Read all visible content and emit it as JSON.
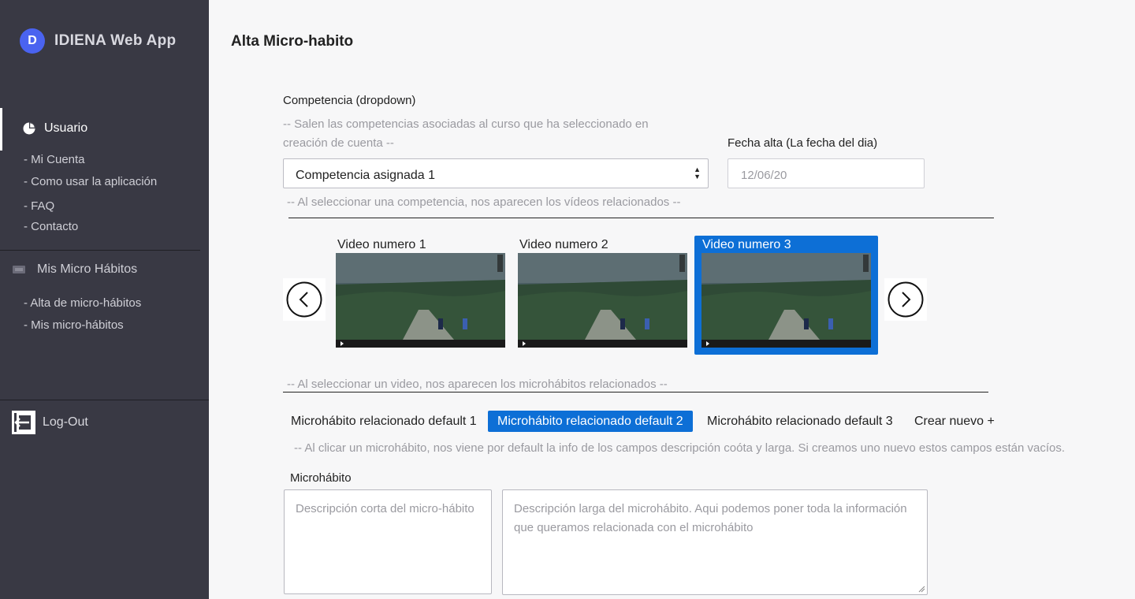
{
  "app": {
    "name": "IDIENA Web App",
    "logo_letter": "D",
    "accent": "#4a63f0"
  },
  "sidebar": {
    "user_section": {
      "label": "Usuario",
      "icon": "pie-chart-icon"
    },
    "user_links": [
      "- Mi Cuenta",
      "- Como usar la aplicación",
      "- FAQ",
      "- Contacto"
    ],
    "micro_section": {
      "label": "Mis Micro Hábitos",
      "icon": "ticket-icon"
    },
    "micro_links": [
      "- Alta de micro-hábitos",
      "- Mis micro-hábitos"
    ],
    "logout": {
      "label": "Log-Out",
      "icon": "logout-icon"
    }
  },
  "main": {
    "title": "Alta Micro-habito",
    "competencia": {
      "label": "Competencia (dropdown)",
      "hint": "-- Salen las competencias asociadas al curso que ha seleccionado en creación de cuenta --",
      "selected": "Competencia asignada 1"
    },
    "fecha": {
      "label": "Fecha alta (La fecha del dia)",
      "placeholder": "12/06/20"
    },
    "videos_hint": "-- Al seleccionar una competencia, nos aparecen los vídeos relacionados --",
    "videos": [
      {
        "title": "Video numero 1",
        "selected": false
      },
      {
        "title": "Video numero 2",
        "selected": false
      },
      {
        "title": "Video numero 3",
        "selected": true
      }
    ],
    "micro_hint": "-- Al seleccionar un video, nos aparecen los microhábitos relacionados --",
    "micro_tabs": [
      {
        "label": "Microhábito relacionado default 1",
        "active": false
      },
      {
        "label": "Microhábito relacionado default 2",
        "active": true
      },
      {
        "label": "Microhábito relacionado default 3",
        "active": false
      },
      {
        "label": "Crear nuevo +",
        "active": false
      }
    ],
    "micro_info_hint": "-- Al clicar un microhábito, nos viene por default la info de los campos descripción coóta y larga. Si creamos uno nuevo estos campos están vacíos.",
    "microhabito": {
      "label": "Microhábito",
      "short_placeholder": "Descripción corta del micro-hábito",
      "long_placeholder": "Descripción larga del microhábito. Aqui podemos poner toda la información que queramos relacionada con el microhábito"
    }
  },
  "colors": {
    "sidebar_bg": "#393944",
    "selected_blue": "#0d6fd6",
    "main_bg": "#f7f7f8"
  }
}
